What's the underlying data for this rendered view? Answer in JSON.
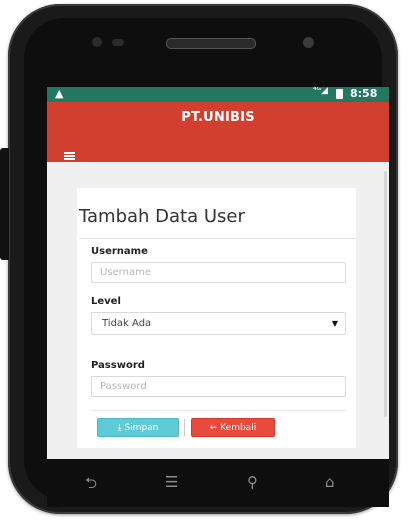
{
  "status_bar": {
    "alert_icon": "warning-icon",
    "network": "⁴ᴳ",
    "time": "8:58"
  },
  "app": {
    "title": "PT.UNIBIS",
    "menu_icon": "hamburger-icon"
  },
  "card": {
    "title": "Tambah Data User"
  },
  "form": {
    "username_label": "Username",
    "username_placeholder": "Username",
    "level_label": "Level",
    "level_value": "Tidak Ada",
    "password_label": "Password",
    "password_placeholder": "Password"
  },
  "buttons": {
    "save": "Simpan",
    "back": "Kembali",
    "separator": "|"
  },
  "nav": {
    "back_icon": "back-icon",
    "home_icon": "home-icon",
    "search_icon": "search-icon",
    "menu_icon": "menu-icon"
  },
  "colors": {
    "status_bar": "#23775f",
    "app_bar": "#d23f2f",
    "save_button": "#5fcbd8",
    "back_button": "#e84b3c"
  }
}
